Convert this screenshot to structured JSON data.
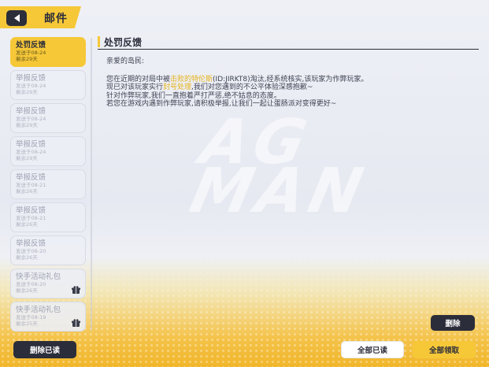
{
  "header": {
    "title": "邮件",
    "back_icon": "back-arrow-icon"
  },
  "mails": [
    {
      "title": "处罚反馈",
      "date": "发送于08-24",
      "left": "剩余29天",
      "active": true,
      "gift": false
    },
    {
      "title": "举报反馈",
      "date": "发送于08-24",
      "left": "剩余29天",
      "active": false,
      "gift": false
    },
    {
      "title": "举报反馈",
      "date": "发送于08-24",
      "left": "剩余29天",
      "active": false,
      "gift": false
    },
    {
      "title": "举报反馈",
      "date": "发送于08-24",
      "left": "剩余29天",
      "active": false,
      "gift": false
    },
    {
      "title": "举报反馈",
      "date": "发送于08-21",
      "left": "剩余26天",
      "active": false,
      "gift": false
    },
    {
      "title": "举报反馈",
      "date": "发送于08-21",
      "left": "剩余26天",
      "active": false,
      "gift": false
    },
    {
      "title": "举报反馈",
      "date": "发送于08-20",
      "left": "剩余26天",
      "active": false,
      "gift": false
    },
    {
      "title": "快手活动礼包",
      "date": "发送于08-20",
      "left": "剩余26天",
      "active": false,
      "gift": true
    },
    {
      "title": "快手活动礼包",
      "date": "发送于08-19",
      "left": "剩余25天",
      "active": false,
      "gift": true
    }
  ],
  "content": {
    "title": "处罚反馈",
    "greeting": "亲爱的岛民:",
    "line1_a": "您在近期的对局中被",
    "line1_hl": "击败的特伦斯",
    "line1_b": "(ID:JIRKT8)淘汰,经系统核实,该玩家为作弊玩家。",
    "line2_a": "现已对该玩家实行",
    "line2_hl": "封号处理",
    "line2_b": ",我们对您遇到的不公平体验深感抱歉~",
    "line3": "针对作弊玩家,我们一直抱着严打严惩,绝不姑息的态度。",
    "line4": "若您在游戏内遇到作弊玩家,请积极举报,让我们一起让蛋肠派对变得更好~"
  },
  "buttons": {
    "delete": "删除",
    "delete_read": "删除已读",
    "read_all": "全部已读",
    "claim_all": "全部领取"
  },
  "colors": {
    "accent": "#f6c838",
    "dark": "#2b2d3a",
    "highlight": "#e7b418"
  }
}
